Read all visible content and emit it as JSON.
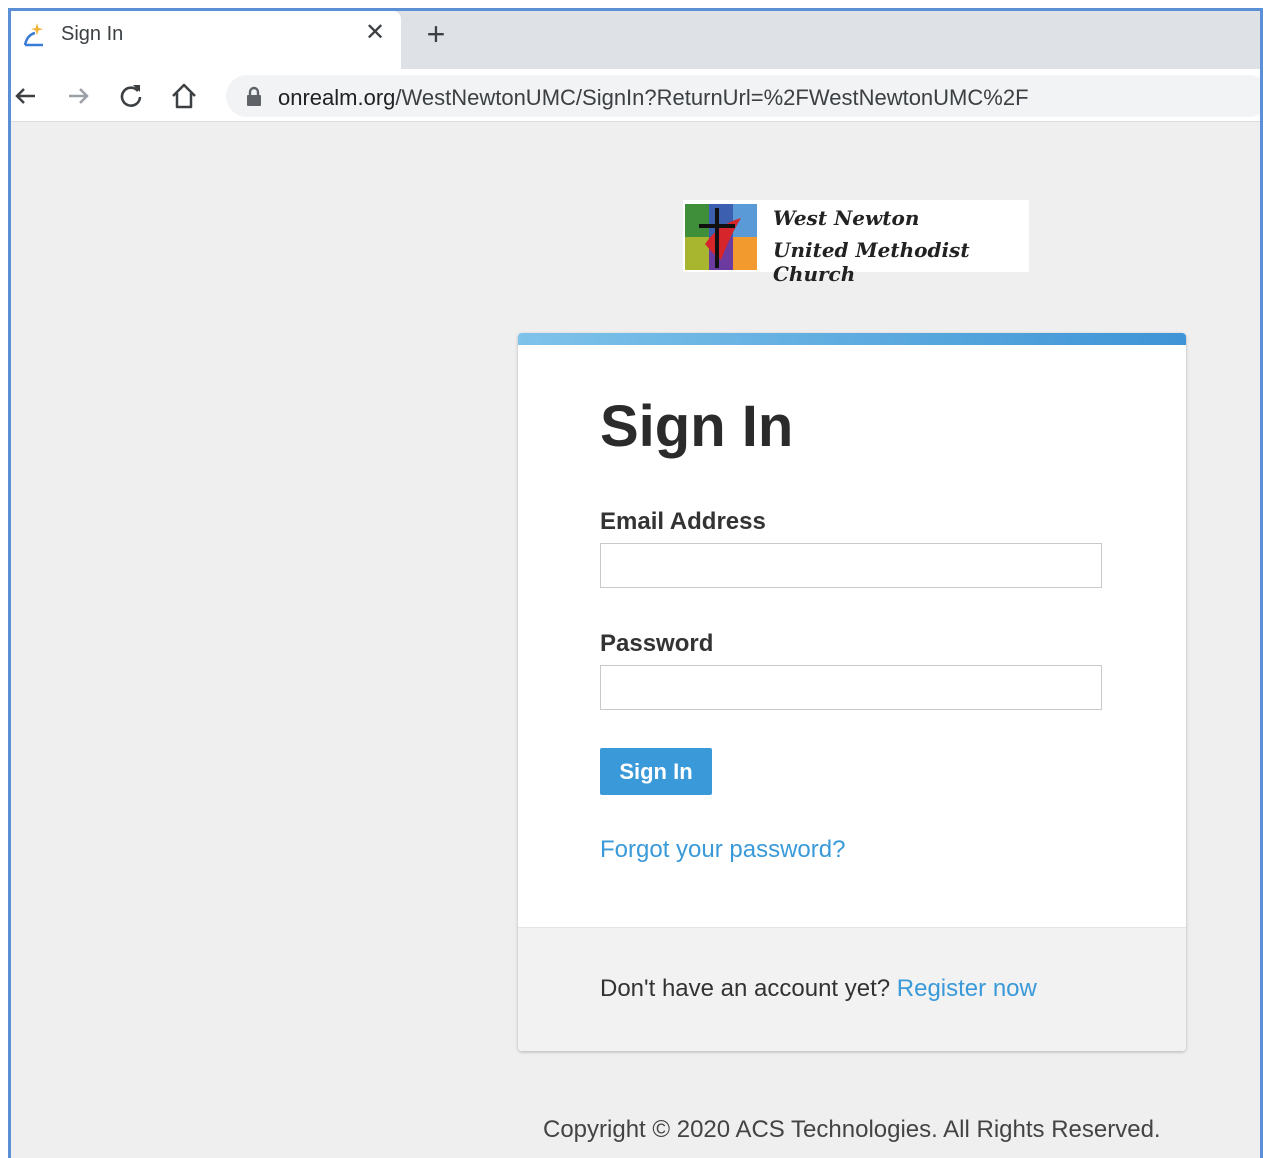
{
  "browser": {
    "tab": {
      "title": "Sign In",
      "close_icon": "close-icon",
      "favicon": "realm-favicon"
    },
    "new_tab_label": "+",
    "toolbar": {
      "back_icon": "back-arrow-icon",
      "forward_icon": "forward-arrow-icon",
      "reload_icon": "reload-icon",
      "home_icon": "home-icon",
      "lock_icon": "lock-icon"
    },
    "url": {
      "host": "onrealm.org",
      "path": "/WestNewtonUMC/SignIn?ReturnUrl=%2FWestNewtonUMC%2F"
    }
  },
  "logo": {
    "line1": "West Newton",
    "line2": "United Methodist Church"
  },
  "card": {
    "title": "Sign In",
    "email_label": "Email Address",
    "email_value": "",
    "password_label": "Password",
    "password_value": "",
    "sign_in_button": "Sign In",
    "forgot_link": "Forgot your password?",
    "footer_prompt": "Don't have an account yet?",
    "register_link": "Register now"
  },
  "copyright": "Copyright © 2020 ACS Technologies. All Rights Reserved.",
  "colors": {
    "accent": "#3a9ad9",
    "page_bg": "#efefef",
    "frame_border": "#5b8fd6"
  }
}
